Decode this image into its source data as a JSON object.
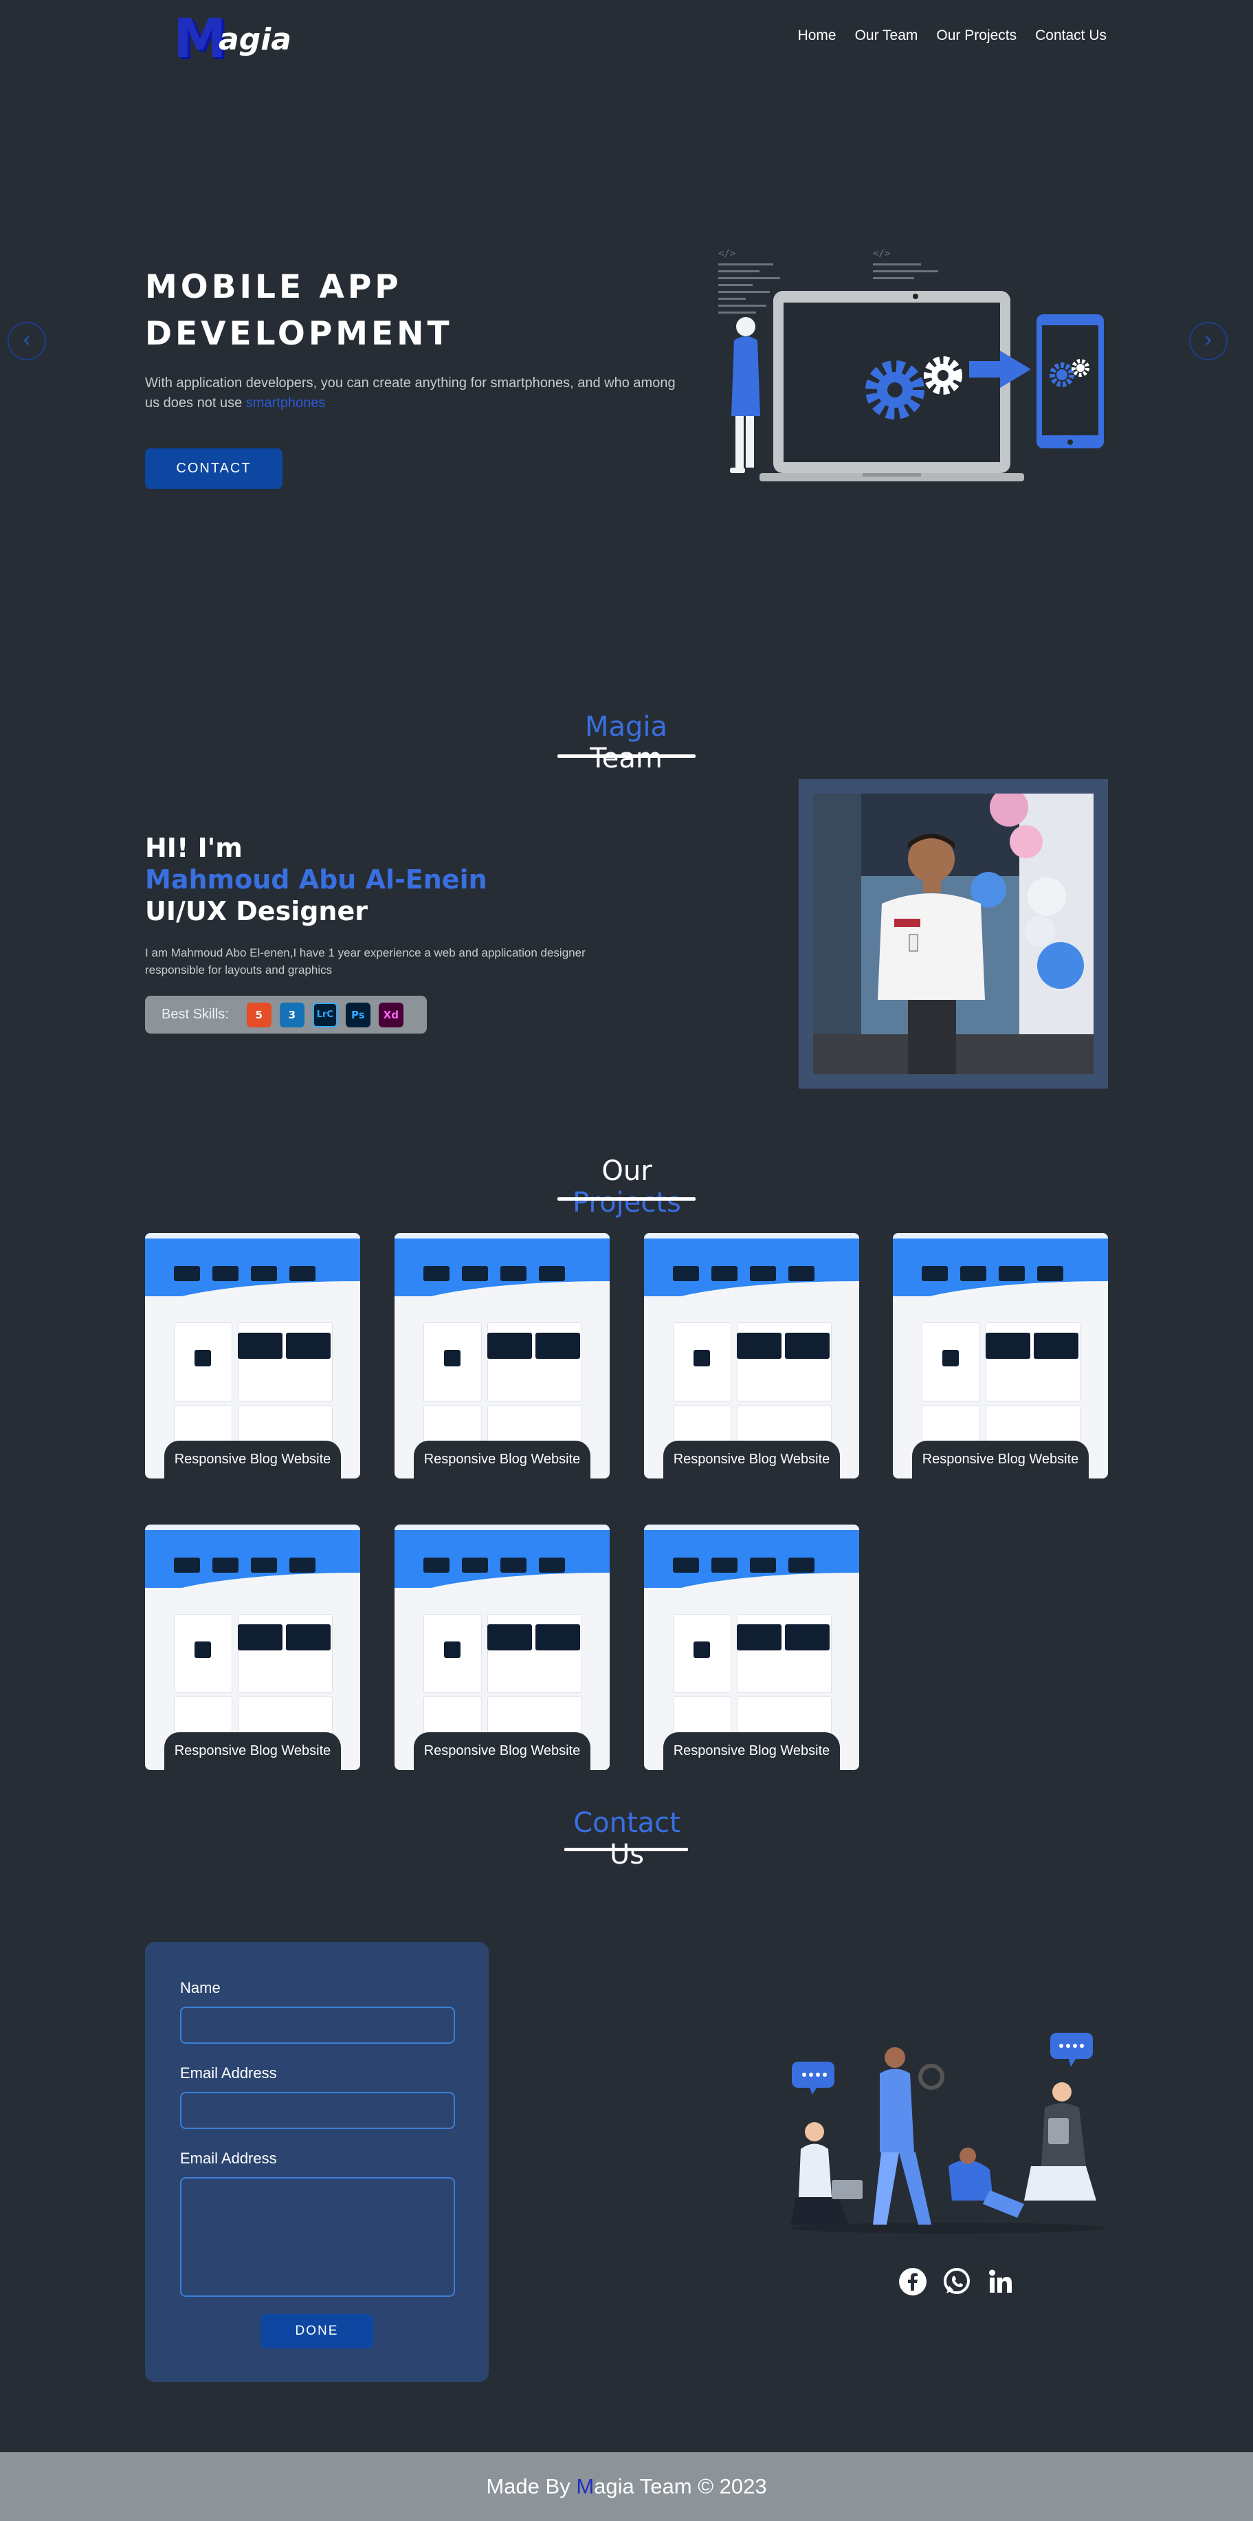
{
  "nav": {
    "logo_first": "M",
    "logo_rest": "agia",
    "links": [
      "Home",
      "Our Team",
      "Our Projects",
      "Contact Us"
    ]
  },
  "hero": {
    "title_line1": "MOBILE APP",
    "title_line2": "DEVELOPMENT",
    "text_before": "With application developers, you can create anything for smartphones, and who among us does not use ",
    "text_highlight": "smartphones",
    "button": "CONTACT",
    "prev_icon": "chevron-left-icon",
    "next_icon": "chevron-right-icon"
  },
  "team": {
    "title_blue": "Magia",
    "title_white": "Team",
    "hi": "HI! I'm",
    "name": "Mahmoud Abu Al-Enein",
    "role": "UI/UX Designer",
    "desc": "I am Mahmoud Abo El-enen,I have 1 year experience a web and application designer responsible for layouts and graphics",
    "skills_label": "Best Skills:",
    "skills": [
      {
        "label": "5",
        "icon": "html5-icon",
        "bg": "#e44d26",
        "fg": "#ffffff"
      },
      {
        "label": "3",
        "icon": "css3-icon",
        "bg": "#1572b6",
        "fg": "#ffffff"
      },
      {
        "label": "LrC",
        "icon": "lightroom-icon",
        "bg": "#001e36",
        "fg": "#31a8ff"
      },
      {
        "label": "Ps",
        "icon": "photoshop-icon",
        "bg": "#001e36",
        "fg": "#31a8ff"
      },
      {
        "label": "Xd",
        "icon": "xd-icon",
        "bg": "#470137",
        "fg": "#ff61f6"
      }
    ]
  },
  "projects": {
    "title_white": "Our",
    "title_blue": "Projects",
    "items": [
      "Responsive Blog Website",
      "Responsive Blog Website",
      "Responsive Blog Website",
      "Responsive Blog Website",
      "Responsive Blog Website",
      "Responsive Blog Website",
      "Responsive Blog Website"
    ]
  },
  "contact": {
    "title_blue": "Contact",
    "title_white": "Us",
    "name_label": "Name",
    "email_label": "Email Address",
    "message_label": "Email Address",
    "button": "DONE",
    "socials": [
      "facebook-icon",
      "whatsapp-icon",
      "linkedin-icon"
    ]
  },
  "footer": {
    "before": "Made By ",
    "m": "M",
    "after": "agia Team © 2023"
  },
  "colors": {
    "background": "#262d35",
    "accent": "#3a6fe0",
    "button": "#0d47a1",
    "form_card": "#2c4570",
    "footer": "#8c9399"
  }
}
